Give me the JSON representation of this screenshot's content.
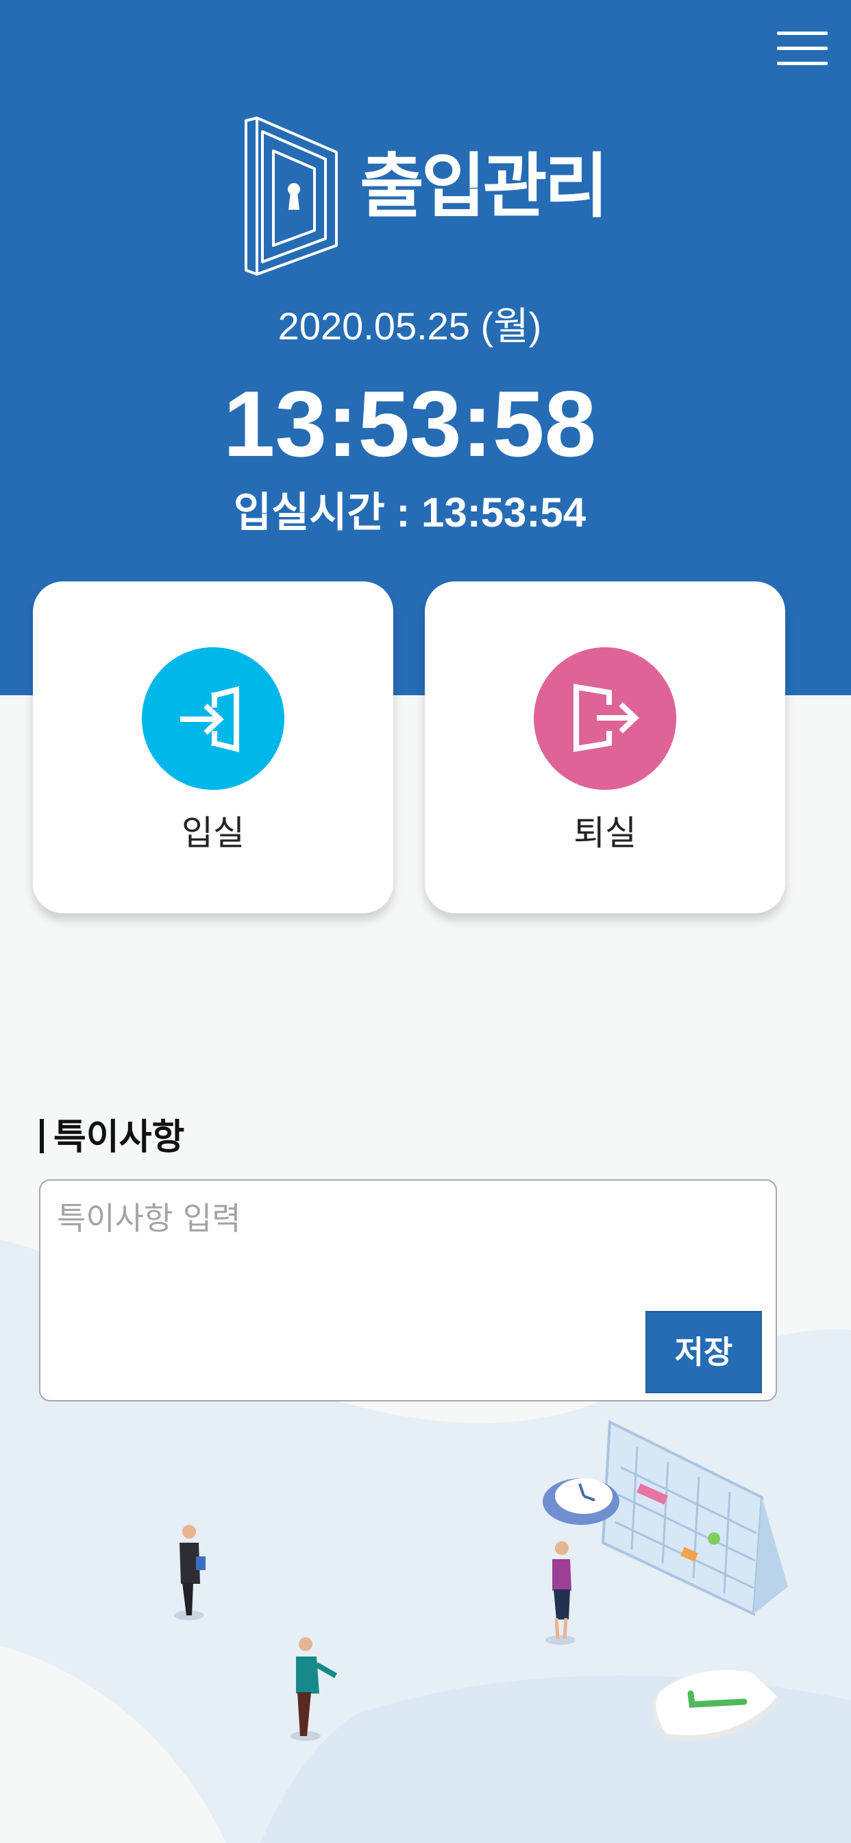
{
  "header": {
    "logo_text": "출입관리",
    "date": "2020.05.25 (월)",
    "clock": "13:53:58",
    "entry_time": "입실시간 : 13:53:54"
  },
  "actions": {
    "enter_label": "입실",
    "exit_label": "퇴실"
  },
  "notes": {
    "title": "특이사항",
    "placeholder": "특이사항 입력",
    "value": "",
    "save_label": "저장"
  },
  "colors": {
    "header_blue": "#266cb5",
    "enter_cyan": "#00b7ea",
    "exit_pink": "#de6498",
    "background": "#f6f7f7"
  },
  "icons": {
    "menu": "hamburger-menu-icon",
    "logo": "door-keyhole-logo",
    "enter": "enter-door-icon",
    "exit": "exit-door-icon"
  }
}
